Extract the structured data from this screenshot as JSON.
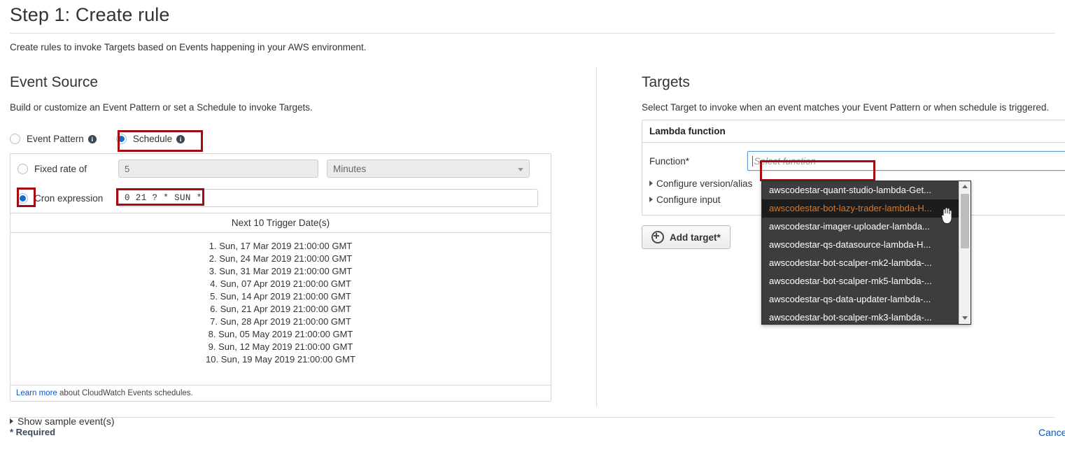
{
  "header": {
    "title": "Step 1: Create rule",
    "intro": "Create rules to invoke Targets based on Events happening in your AWS environment."
  },
  "event_source": {
    "heading": "Event Source",
    "subtitle": "Build or customize an Event Pattern or set a Schedule to invoke Targets.",
    "mode_options": [
      {
        "label": "Event Pattern",
        "selected": false
      },
      {
        "label": "Schedule",
        "selected": true
      }
    ],
    "fixed_rate": {
      "label": "Fixed rate of",
      "value": "5",
      "unit": "Minutes",
      "selected": false
    },
    "cron": {
      "label": "Cron expression",
      "value": "0 21 ? * SUN *",
      "selected": true
    },
    "trigger_table_header": "Next 10 Trigger Date(s)",
    "trigger_dates": [
      "1. Sun, 17 Mar 2019 21:00:00 GMT",
      "2. Sun, 24 Mar 2019 21:00:00 GMT",
      "3. Sun, 31 Mar 2019 21:00:00 GMT",
      "4. Sun, 07 Apr 2019 21:00:00 GMT",
      "5. Sun, 14 Apr 2019 21:00:00 GMT",
      "6. Sun, 21 Apr 2019 21:00:00 GMT",
      "7. Sun, 28 Apr 2019 21:00:00 GMT",
      "8. Sun, 05 May 2019 21:00:00 GMT",
      "9. Sun, 12 May 2019 21:00:00 GMT",
      "10. Sun, 19 May 2019 21:00:00 GMT"
    ],
    "learn_more_link": "Learn more",
    "learn_more_rest": " about CloudWatch Events schedules.",
    "show_sample_events": "Show sample event(s)"
  },
  "targets": {
    "heading": "Targets",
    "subtitle": "Select Target to invoke when an event matches your Event Pattern or when schedule is triggered.",
    "card_title": "Lambda function",
    "function_label": "Function*",
    "function_value": "",
    "function_placeholder": "Select function",
    "configure_version_alias": "Configure version/alias",
    "configure_input": "Configure input",
    "add_target_label": "Add target*",
    "dropdown": {
      "items": [
        {
          "label": "awscodestar-quant-studio-lambda-Get...",
          "hovered": false
        },
        {
          "label": "awscodestar-bot-lazy-trader-lambda-H...",
          "hovered": true
        },
        {
          "label": "awscodestar-imager-uploader-lambda...",
          "hovered": false
        },
        {
          "label": "awscodestar-qs-datasource-lambda-H...",
          "hovered": false
        },
        {
          "label": "awscodestar-bot-scalper-mk2-lambda-...",
          "hovered": false
        },
        {
          "label": "awscodestar-bot-scalper-mk5-lambda-...",
          "hovered": false
        },
        {
          "label": "awscodestar-qs-data-updater-lambda-...",
          "hovered": false
        },
        {
          "label": "awscodestar-bot-scalper-mk3-lambda-...",
          "hovered": false
        }
      ]
    }
  },
  "footer": {
    "required_note": "* Required",
    "cancel_label": "Cancel"
  },
  "colors": {
    "accent_blue": "#0f6fce",
    "link_blue": "#0a57c2",
    "highlight_red": "#a40b11",
    "dropdown_bg": "#3d3d3d",
    "dropdown_hover_bg": "#1c1c1c",
    "dropdown_hover_text": "#e2761b"
  }
}
